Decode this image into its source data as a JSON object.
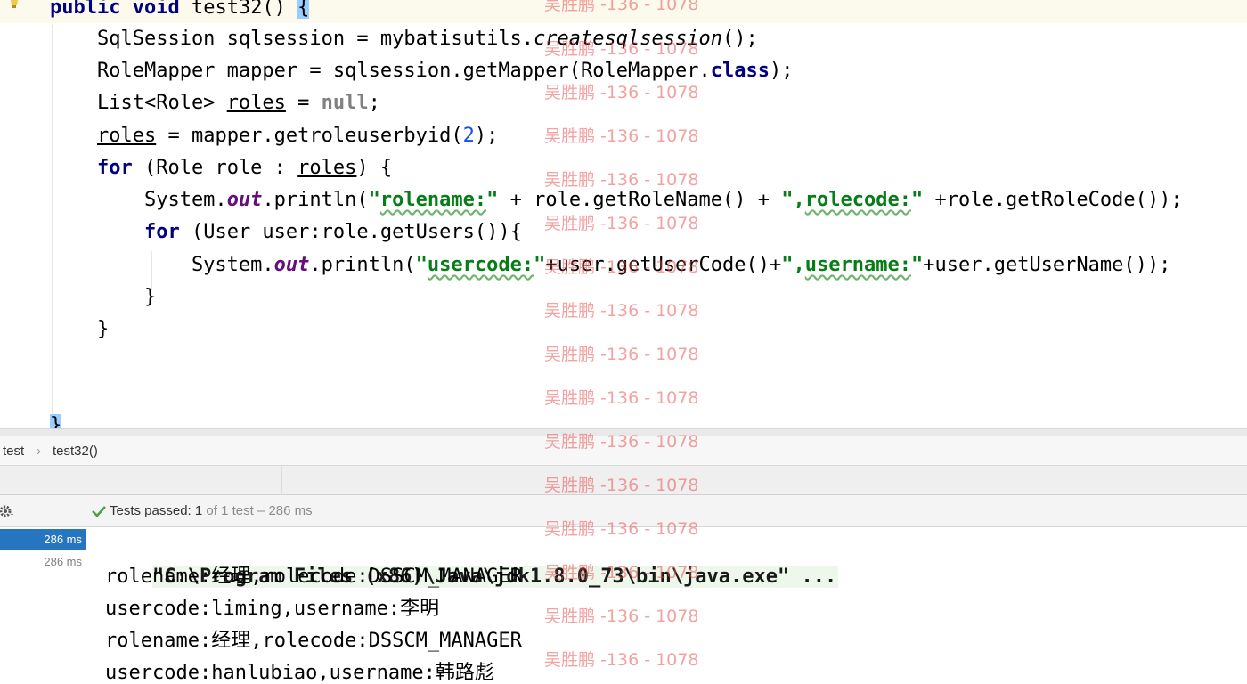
{
  "editor": {
    "code_lines": [
      [
        {
          "t": "public",
          "c": "kw"
        },
        {
          "t": " "
        },
        {
          "t": "void",
          "c": "kw"
        },
        {
          "t": " test32() "
        },
        {
          "t": "{",
          "c": "brace-hl"
        }
      ],
      [
        {
          "t": "    SqlSession sqlsession = mybatisutils."
        },
        {
          "t": "createsqlsession",
          "c": "ital"
        },
        {
          "t": "();"
        }
      ],
      [
        {
          "t": "    RoleMapper mapper = sqlsession.getMapper(RoleMapper."
        },
        {
          "t": "class",
          "c": "kw"
        },
        {
          "t": ");"
        }
      ],
      [
        {
          "t": "    List<Role> "
        },
        {
          "t": "roles",
          "c": "ul"
        },
        {
          "t": " = "
        },
        {
          "t": "null",
          "c": "gray"
        },
        {
          "t": ";"
        }
      ],
      [
        {
          "t": "    "
        },
        {
          "t": "roles",
          "c": "ul"
        },
        {
          "t": " = mapper.getroleuserbyid("
        },
        {
          "t": "2",
          "c": "num"
        },
        {
          "t": ");"
        }
      ],
      [
        {
          "t": "    "
        },
        {
          "t": "for",
          "c": "kw"
        },
        {
          "t": " (Role role : "
        },
        {
          "t": "roles",
          "c": "ul"
        },
        {
          "t": ") {"
        }
      ],
      [
        {
          "t": "        System."
        },
        {
          "t": "out",
          "c": "fld"
        },
        {
          "t": ".println("
        },
        {
          "t": "\"",
          "c": "str"
        },
        {
          "t": "rolename:",
          "c": "str wav"
        },
        {
          "t": "\"",
          "c": "str"
        },
        {
          "t": " + role.getRoleName() + "
        },
        {
          "t": "\",",
          "c": "str"
        },
        {
          "t": "rolecode:",
          "c": "str wav"
        },
        {
          "t": "\"",
          "c": "str"
        },
        {
          "t": " +role.getRoleCode());"
        }
      ],
      [
        {
          "t": "        "
        },
        {
          "t": "for",
          "c": "kw"
        },
        {
          "t": " (User user:role.getUsers()){"
        }
      ],
      [
        {
          "t": "            System."
        },
        {
          "t": "out",
          "c": "fld"
        },
        {
          "t": ".println("
        },
        {
          "t": "\"",
          "c": "str"
        },
        {
          "t": "usercode:",
          "c": "str wav"
        },
        {
          "t": "\"",
          "c": "str"
        },
        {
          "t": "+user.getUserCode()+"
        },
        {
          "t": "\",",
          "c": "str"
        },
        {
          "t": "username:",
          "c": "str wav"
        },
        {
          "t": "\"",
          "c": "str"
        },
        {
          "t": "+user.getUserName());"
        }
      ],
      [
        {
          "t": "        }"
        }
      ],
      [
        {
          "t": "    }"
        }
      ],
      [
        {
          "t": ""
        }
      ],
      [
        {
          "t": "}",
          "c": "brace-hl"
        }
      ]
    ]
  },
  "breadcrumb": {
    "items": [
      "test",
      "test32()"
    ],
    "separator": "›"
  },
  "test_toolbar": {
    "status_label": "Tests passed:",
    "passed_count": "1",
    "of_text": "of 1 test – 286 ms",
    "status_color": "#4aa14a"
  },
  "test_tree": {
    "rows": [
      {
        "duration": "286 ms",
        "selected": true
      },
      {
        "duration": "286 ms",
        "selected": false
      }
    ]
  },
  "console": {
    "command": "\"C:\\Program Files (x86)\\Java\\jdk1.8.0_73\\bin\\java.exe\" ...",
    "lines": [
      "rolename:经理,rolecode:DSSCM_MANAGER",
      "usercode:liming,username:李明",
      "rolename:经理,rolecode:DSSCM_MANAGER",
      "usercode:hanlubiao,username:韩路彪"
    ]
  },
  "watermark": {
    "text": "吴胜鹏 -136 - 1078",
    "color": "#e84646"
  }
}
